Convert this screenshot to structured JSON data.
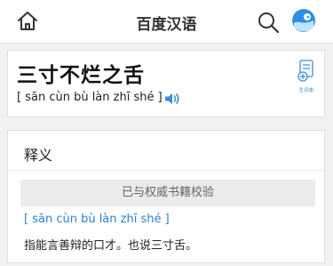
{
  "header": {
    "title": "百度汉语",
    "home_icon": "home-icon",
    "search_icon": "search-icon",
    "avatar_icon": "avatar"
  },
  "entry": {
    "word": "三寸不烂之舌",
    "pinyin": "[ sān cùn bù làn zhī shé ]",
    "audio_icon": "speaker-icon",
    "wordbook_label": "生词本"
  },
  "definition": {
    "heading": "释义",
    "verified_text": "已与权威书籍校验",
    "pinyin": "[ sān cùn bù làn zhī shé ]",
    "text": "指能言善辩的口才。也说三寸舌。"
  },
  "colors": {
    "accent": "#3a8fd8",
    "pinyin_link": "#2e7fd1",
    "background": "#f2f2f2"
  }
}
